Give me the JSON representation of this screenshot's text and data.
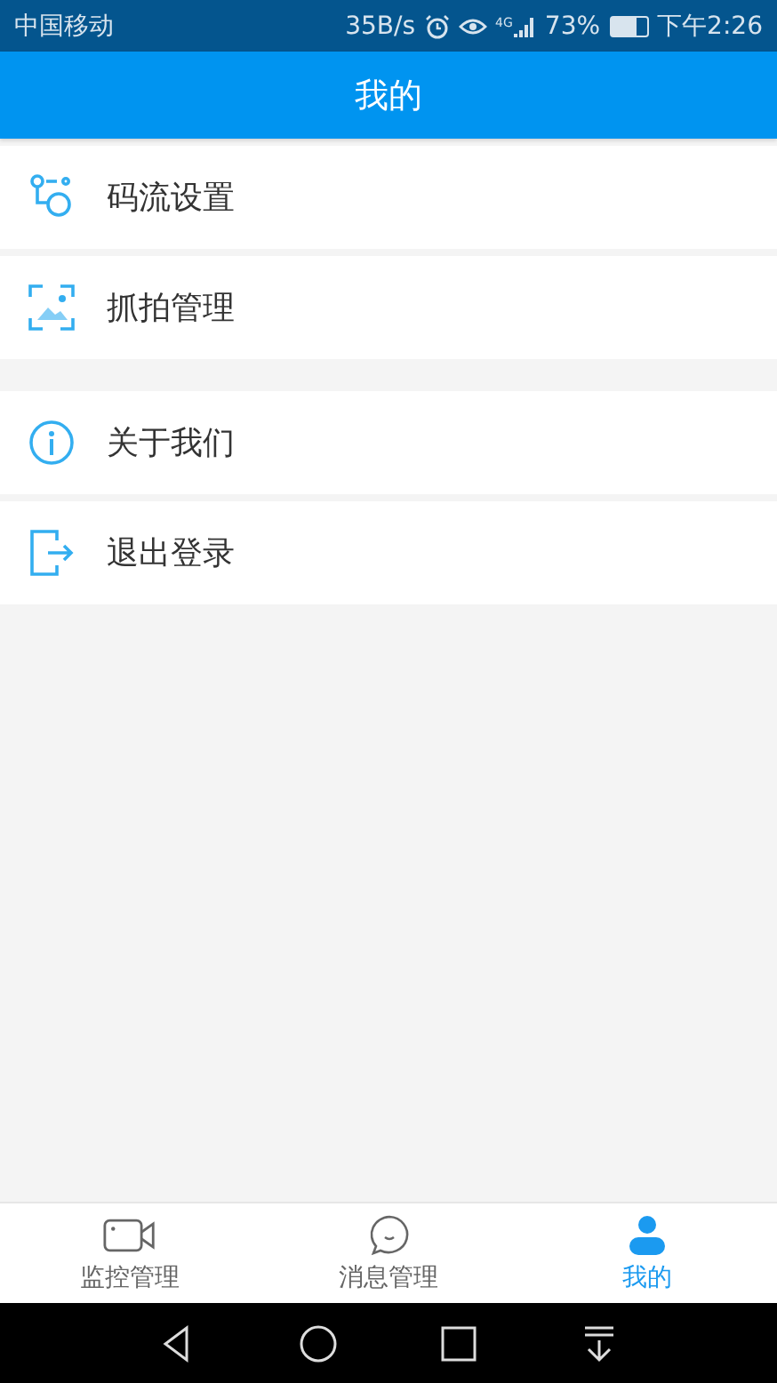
{
  "status_bar": {
    "carrier": "中国移动",
    "speed": "35B/s",
    "network": "4G",
    "battery": "73%",
    "time": "下午2:26"
  },
  "header": {
    "title": "我的"
  },
  "menu_groups": [
    {
      "items": [
        {
          "kind": "stream",
          "label": "码流设置"
        },
        {
          "kind": "snapshot",
          "label": "抓拍管理"
        }
      ]
    },
    {
      "items": [
        {
          "kind": "about",
          "label": "关于我们"
        },
        {
          "kind": "logout",
          "label": "退出登录"
        }
      ]
    }
  ],
  "tabs": [
    {
      "kind": "camera",
      "label": "监控管理",
      "selected": false
    },
    {
      "kind": "message",
      "label": "消息管理",
      "selected": false
    },
    {
      "kind": "person",
      "label": "我的",
      "selected": true
    }
  ]
}
